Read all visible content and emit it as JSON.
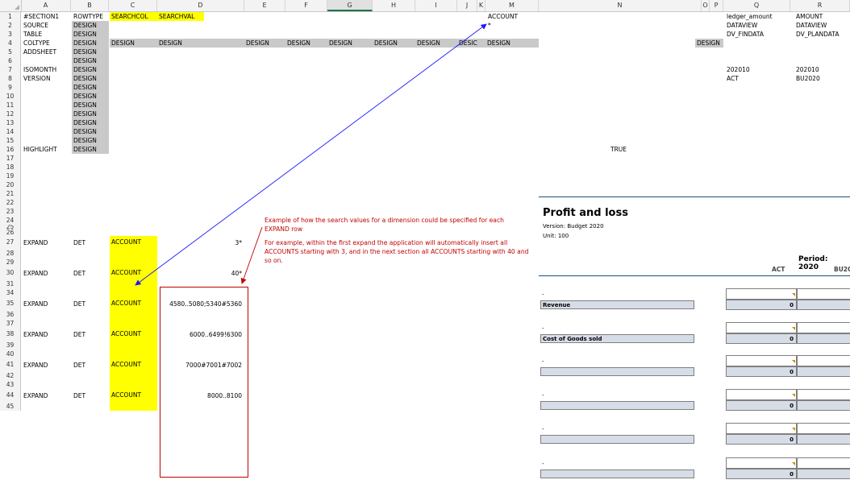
{
  "columns": [
    "A",
    "B",
    "C",
    "D",
    "E",
    "F",
    "G",
    "H",
    "I",
    "J",
    "K",
    "M",
    "N",
    "O",
    "P",
    "Q",
    "R"
  ],
  "rows": [
    "1",
    "2",
    "3",
    "4",
    "5",
    "6",
    "7",
    "8",
    "9",
    "10",
    "11",
    "12",
    "13",
    "14",
    "15",
    "16",
    "17",
    "18",
    "19",
    "20",
    "21",
    "22",
    "23",
    "24",
    "25",
    "26",
    "27",
    "28",
    "29",
    "30",
    "31",
    "34",
    "35",
    "36",
    "37",
    "38",
    "39",
    "40",
    "41",
    "42",
    "43",
    "44",
    "45"
  ],
  "colA": {
    "r1": "#SECTION1",
    "r2": "SOURCE",
    "r3": "TABLE",
    "r4": "COLTYPE",
    "r5": "ADDSHEET",
    "r7": "ISOMONTH",
    "r8": "VERSION",
    "r16": "HIGHLIGHT",
    "r27": "EXPAND",
    "r30": "EXPAND",
    "r35": "EXPAND",
    "r38": "EXPAND",
    "r41": "EXPAND",
    "r44": "EXPAND"
  },
  "colB_header": "ROWTYPE",
  "design": "DESIGN",
  "det": "DET",
  "searchcol": "SEARCHCOL",
  "searchval": "SEARCHVAL",
  "account": "ACCOUNT",
  "asterisk": "*",
  "true_text": "TRUE",
  "desic": "DESIC",
  "dvals": [
    "3*",
    "40*",
    "4580..5080;5340#5360",
    "6000..6499!6300",
    "7000#7001#7002",
    "8000..8100"
  ],
  "colQ": {
    "r1": "ledger_amount",
    "r2": "DATAVIEW",
    "r3": "DV_FINDATA",
    "r7": "202010",
    "r8": "ACT"
  },
  "colR": {
    "r1": "AMOUNT",
    "r2": "DATAVIEW",
    "r3": "DV_PLANDATA",
    "r7": "202010",
    "r8": "BU2020"
  },
  "note": {
    "p1": "Example of how the search values for a dimension could be specified for each EXPAND row",
    "p2": "For example, within the first expand the application will automatically insert all ACCOUNTS starting with 3, and in the next section all ACCOUNTS starting with 40 and so on."
  },
  "pl": {
    "title": "Profit and loss",
    "version": "Version: Budget 2020",
    "unit": "Unit: 100",
    "period": "Period: 2020",
    "col_act": "ACT",
    "col_bu": "BU2C",
    "dash": "-",
    "zero": "0",
    "labels": [
      "Revenue",
      "Cost of Goods sold",
      "",
      "",
      "",
      ""
    ]
  },
  "colors": {
    "yellow": "#ffff00",
    "grey": "#c9c9c9",
    "red": "#c00000",
    "blue": "#1f4e79",
    "arrow": "#0000ff"
  }
}
